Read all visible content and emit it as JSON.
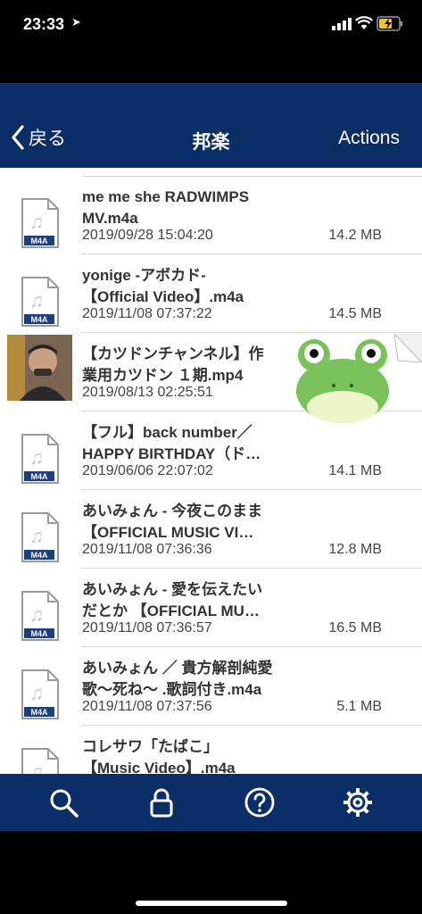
{
  "status": {
    "time": "23:33"
  },
  "nav": {
    "back_label": "戻る",
    "title": "邦楽",
    "actions_label": "Actions"
  },
  "files": [
    {
      "name_line1": "me me she RADWIMPS",
      "name_line2": "MV.m4a",
      "date": "2019/09/28 15:04:20",
      "size": "14.2 MB",
      "type": "M4A"
    },
    {
      "name_line1": "yonige -アボカド-",
      "name_line2": "【Official Video】.m4a",
      "date": "2019/11/08 07:37:22",
      "size": "14.5 MB",
      "type": "M4A"
    },
    {
      "name_line1": "【カツドンチャンネル】作",
      "name_line2": "業用カツドン １期.mp4",
      "date": "2019/08/13 02:25:51",
      "size": "",
      "type": "video"
    },
    {
      "name_line1": "【フル】back number／",
      "name_line2": "HAPPY BIRTHDAY（ド…",
      "date": "2019/06/06 22:07:02",
      "size": "14.1 MB",
      "type": "M4A"
    },
    {
      "name_line1": "あいみょん - 今夜このまま",
      "name_line2": "【OFFICIAL MUSIC VI…",
      "date": "2019/11/08 07:36:36",
      "size": "12.8 MB",
      "type": "M4A"
    },
    {
      "name_line1": "あいみょん - 愛を伝えたい",
      "name_line2": "だとか 【OFFICIAL MU…",
      "date": "2019/11/08 07:36:57",
      "size": "16.5 MB",
      "type": "M4A"
    },
    {
      "name_line1": "あいみょん ／ 貴方解剖純愛",
      "name_line2": "歌〜死ね〜 .歌詞付き.m4a",
      "date": "2019/11/08 07:37:56",
      "size": "5.1 MB",
      "type": "M4A"
    },
    {
      "name_line1": "コレサワ「たばこ」",
      "name_line2": "【Music Video】.m4a",
      "date": "",
      "size": "",
      "type": "M4A"
    }
  ],
  "file_badge": "M4A",
  "tabs": [
    "search-icon",
    "lock-icon",
    "help-icon",
    "gear-icon"
  ],
  "colors": {
    "nav_bg": "#0b2e66",
    "list_bg": "#ffffff",
    "badge": "#1f3f7a",
    "frog": "#7ac35a"
  }
}
